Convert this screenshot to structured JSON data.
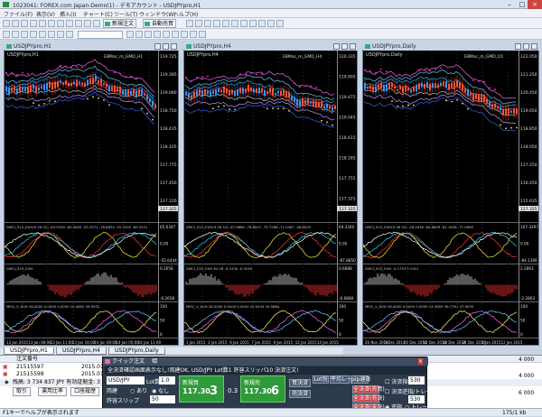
{
  "app": {
    "title": "1023041: FOREX.com Japan-Demo(1) - デモアカウント - USDJPYpro,H1"
  },
  "menu": [
    "ファイル(F)",
    "表示(V)",
    "挿入(I)",
    "チャート(C)",
    "ツール(T)",
    "ウィンドウ(W)",
    "ヘルプ(H)"
  ],
  "toolbar": {
    "new_order": "新規注文",
    "auto_trade": "自動売買"
  },
  "charts": [
    {
      "title": "USDJPYpro,H1",
      "symbol_label": "USDJPYpro,H1",
      "ind_label": "EBMac_m_GMD_H1",
      "prices": [
        "119.725",
        "119.395",
        "119.080",
        "118.750",
        "118.435",
        "118.105",
        "117.775",
        "117.450",
        "117.120"
      ],
      "cur_price": "117.325",
      "osc1_label": "GMCI_S1V_EUH(9 26 52) -83.0330 -85.0090 -53.2571 -78.8634 -55.3333 -60.0331",
      "osc1_ticks": [
        "65.6347",
        "0.00",
        "-55.6444"
      ],
      "osc2_label": "GMCI_S1V_EUH",
      "osc2_ticks": [
        "0.2658",
        "-0.2658"
      ],
      "osc3_label": "MIS2_V_EUH 28.0000 0.0000 0.0000 15.4852 36.9932",
      "osc3_ticks": [
        "100",
        "50",
        "0"
      ],
      "dates": [
        "13 Jan 2015",
        "13 Jan 06:00",
        "13 Jan 11:00",
        "13 Jan 16:00",
        "14 Jan 00:00",
        "14 Jan 05:00",
        "14 Jan 11:00"
      ]
    },
    {
      "title": "USDJPYpro,H4",
      "symbol_label": "USDJPYpro,H4",
      "ind_label": "EBMac_m_GMD_H4",
      "prices": [
        "120.335",
        "119.905",
        "119.475",
        "119.045",
        "118.615",
        "118.185",
        "117.755",
        "117.325"
      ],
      "cur_price": "117.325",
      "osc1_label": "GMCI_S1V_EUH(9 26 52) -67.6680 -76.8547 -75.7266 -71.0467 -48.8033",
      "osc1_ticks": [
        "64.3340",
        "0.00",
        "-87.8850"
      ],
      "osc2_label": "GMCI_S1V_EUH 62.28 -0.2430 -0.3249",
      "osc2_ticks": [
        "0.6888",
        "-0.6888"
      ],
      "osc3_label": "MIS2_V_EUH 28.0000 0.0000 0.0000 20.0434 34.9884",
      "osc3_ticks": [
        "100",
        "50",
        "0"
      ],
      "dates": [
        "1 Jan 2015",
        "2 Jan 2015",
        "6 Jan 2015",
        "7 Jan 2015",
        "9 Jan 2015",
        "12 Jan 2015",
        "14 Jan 2015"
      ]
    },
    {
      "title": "USDJPYpro,Daily",
      "symbol_label": "USDJPYpro,Daily",
      "ind_label": "EBMac_m_GMD_D1",
      "prices": [
        "122.050",
        "121.250",
        "120.450",
        "119.650",
        "118.850",
        "118.050",
        "117.250",
        "116.450",
        "115.635"
      ],
      "cur_price": "117.325",
      "osc1_label": "GMCI_S1V_EUH(9 26 52) -26.1838 -64.9839 -81.1636 -77.0856",
      "osc1_ticks": [
        "107.3297",
        "0.00",
        "-84.1306"
      ],
      "osc2_label": "GMCI_S1V_EUH -0.1733 0.1911",
      "osc2_ticks": [
        "2.2863",
        "-2.2863"
      ],
      "osc3_label": "MIS2_V_EUH 28.0000 0.0000 0.0000 13.3605 36.7761 37.9030",
      "osc3_ticks": [
        "100",
        "50",
        "0"
      ],
      "dates": [
        "26 Nov 2014",
        "3 Dec 2014",
        "10 Dec 2014",
        "15 Dec 2014",
        "18 Dec 2014",
        "24 Dec 2014",
        "2 Jan 2015",
        "12 Jan 2015"
      ]
    }
  ],
  "tabs": [
    "USDJPYpro,H1",
    "USDJPYpro,H4",
    "USDJPYpro,Daily"
  ],
  "terminal": {
    "hdr_order": "注文番号",
    "rows": [
      {
        "id": "21515597",
        "date": "2015.01"
      },
      {
        "id": "21515598",
        "date": "2015.01"
      }
    ],
    "balance": "残高: 3 734 837 JPY  有効証拠金: 3 734 837",
    "bottom_tabs": [
      "取引",
      "運用比率",
      "口座履歴"
    ],
    "right_values": [
      "4 000",
      "4 000",
      "6 000"
    ]
  },
  "quick_order": {
    "title": "クイック注文",
    "title2": "傾",
    "message": "全決済確認画面表示なし!両建OK, USD/JPY Lot数1 許容スリッパ10 決済注文!",
    "symbol": "USD/JPY",
    "lot_label": "Lot数",
    "lot_value": "1.0",
    "hedge_label": "両建",
    "hedge_yes": "あり",
    "hedge_no": "なし",
    "slip_label": "許容スリップ",
    "slip_value": "50",
    "buy_label": "新規買",
    "buy_price": "117.30",
    "buy_sup": "3",
    "spread": "0.3",
    "sell_label": "新規売",
    "sell_price": "117.30",
    "sell_sup": "6",
    "btn_buy_close": "買決済",
    "btn_sell_close": "売決済",
    "btn_lot_close": "Lot別",
    "btn_avg": "平均レート",
    "btn_pip": "pip通貨",
    "btn_all1": "全決済(売買)",
    "btn_all2": "全決済(売決)",
    "btn_all3": "全決済(全決)",
    "chk_sl": "決済指値",
    "chk_tr": "決済逆指/トレール",
    "rad_limit": "逆指",
    "rad_trail": "トレール",
    "sl_value": "530",
    "tr_value": "530"
  },
  "statusbar": {
    "help": "F1キーでヘルプが表示されます",
    "right": "175/1 kb"
  }
}
